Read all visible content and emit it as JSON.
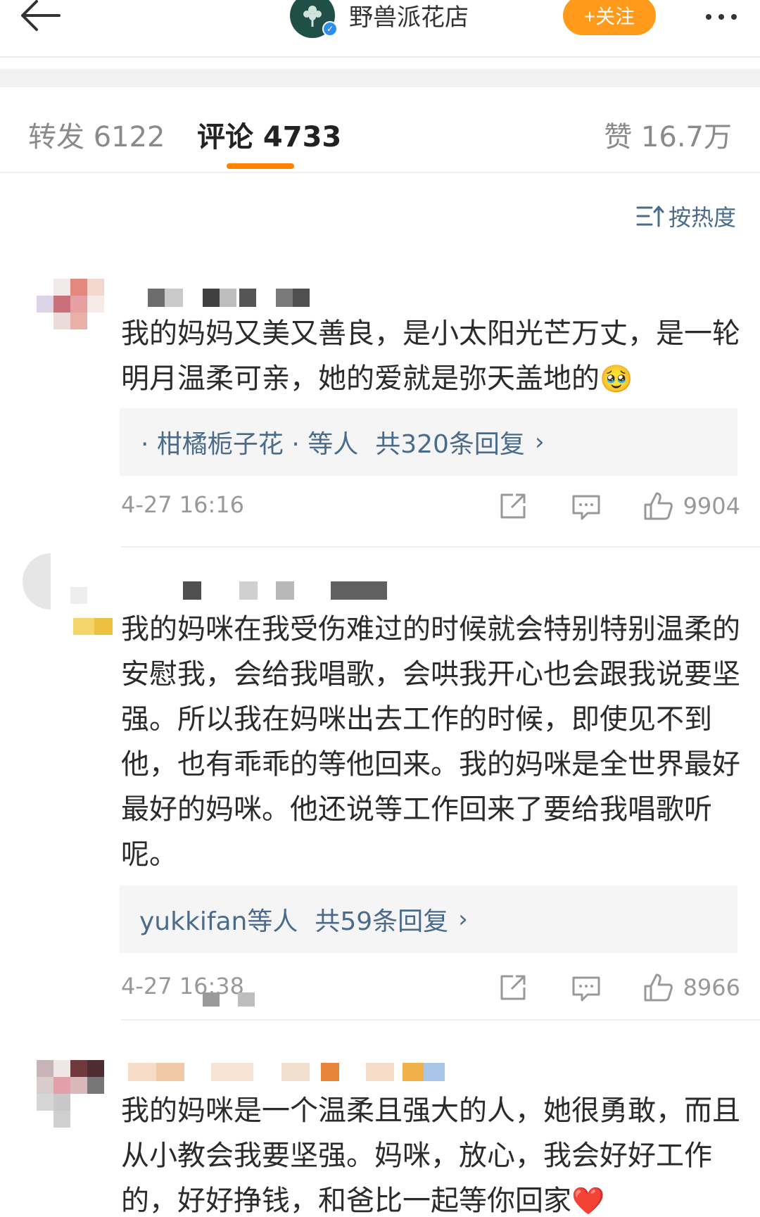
{
  "header": {
    "account_name": "野兽派花店",
    "follow_label": "+关注",
    "icons": [
      "back-arrow-icon",
      "tree-logo-icon",
      "verified-icon",
      "more-icon"
    ]
  },
  "tabs": {
    "repost": "转发 6122",
    "comment": "评论 4733",
    "like": "赞 16.7万"
  },
  "sort": {
    "label": "按热度",
    "icon": "sort-icon"
  },
  "accent_color": "#ff8200",
  "link_color": "#4a6b8a",
  "comments": [
    {
      "text": "我的妈妈又美又善良，是小太阳光芒万丈，是一轮明月温柔可亲，她的爱就是弥天盖地的",
      "emoji": "🥹",
      "reply_users": "· 柑橘栀子花 · 等人",
      "reply_count": "共320条回复",
      "time": "4-27 16:16",
      "likes": "9904"
    },
    {
      "text": "我的妈咪在我受伤难过的时候就会特别特别温柔的安慰我，会给我唱歌，会哄我开心也会跟我说要坚强。所以我在妈咪出去工作的时候，即使见不到他，也有乖乖的等他回来。我的妈咪是全世界最好最好的妈咪。他还说等工作回来了要给我唱歌听呢。",
      "reply_users": "yukkifan等人",
      "reply_count": "共59条回复",
      "time": "4-27 16:38",
      "likes": "8966"
    },
    {
      "text": "我的妈咪是一个温柔且强大的人，她很勇敢，而且从小教会我要坚强。妈咪，放心，我会好好工作的，好好挣钱，和爸比一起等你回家",
      "emoji": "❤️"
    }
  ]
}
